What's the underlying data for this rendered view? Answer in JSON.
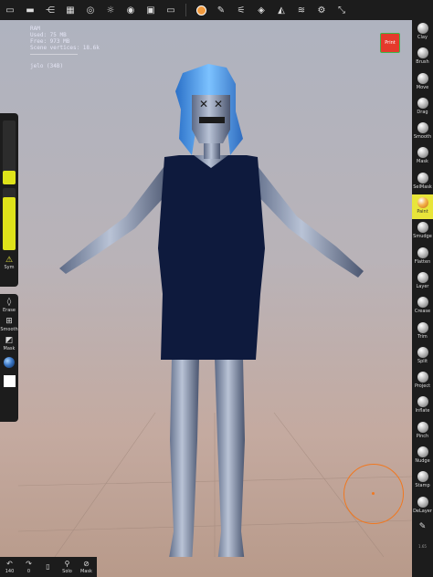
{
  "topbar": {
    "icons": [
      "files-icon",
      "folder-icon",
      "scene-tree-icon",
      "grid-icon",
      "target-icon",
      "sun-icon",
      "material-icon",
      "image-icon",
      "camera-icon",
      "orange-dot-icon",
      "pen-icon",
      "brush-settings-icon",
      "snapshot-icon",
      "symmetry-icon",
      "layers-icon",
      "settings-icon",
      "collapse-icon"
    ]
  },
  "stats": {
    "ram": "RAM",
    "used": "Used: 75 MB",
    "free": "Free: 973 MB",
    "scene_vertices": "Scene vertices: 18.6k",
    "selection": "jelo (34B)"
  },
  "print_button": {
    "label": "Print"
  },
  "right_tools": [
    {
      "label": "Clay",
      "icon": "clay-icon"
    },
    {
      "label": "Brush",
      "icon": "brush-icon"
    },
    {
      "label": "Move",
      "icon": "move-icon"
    },
    {
      "label": "Drag",
      "icon": "drag-icon"
    },
    {
      "label": "Smooth",
      "icon": "smooth-icon"
    },
    {
      "label": "Mask",
      "icon": "mask-icon"
    },
    {
      "label": "SelMask",
      "icon": "selmask-icon"
    },
    {
      "label": "Paint",
      "icon": "paint-icon",
      "active": true
    },
    {
      "label": "Smudge",
      "icon": "smudge-icon"
    },
    {
      "label": "Flatten",
      "icon": "flatten-icon"
    },
    {
      "label": "Layer",
      "icon": "layer-icon"
    },
    {
      "label": "Crease",
      "icon": "crease-icon"
    },
    {
      "label": "Trim",
      "icon": "trim-icon"
    },
    {
      "label": "Split",
      "icon": "split-icon"
    },
    {
      "label": "Project",
      "icon": "project-icon"
    },
    {
      "label": "Inflate",
      "icon": "inflate-icon"
    },
    {
      "label": "Pinch",
      "icon": "pinch-icon"
    },
    {
      "label": "Nudge",
      "icon": "nudge-icon"
    },
    {
      "label": "Stamp",
      "icon": "stamp-icon"
    },
    {
      "label": "DeLayer",
      "icon": "delayer-icon"
    },
    {
      "label": "",
      "icon": "pencil-icon"
    }
  ],
  "right_panel_version": "1.65",
  "left_panel": {
    "sym_label": "Sym",
    "radius_level": 0.22,
    "intensity_level": 0.85,
    "erase_label": "Erase",
    "smooth_label": "Smooth",
    "mask_label": "Mask"
  },
  "bottombar": {
    "undo_label": "140",
    "redo_label": "0",
    "item3_label": "",
    "solo_label": "Solo",
    "mask_label": "Mask"
  },
  "colors": {
    "toolbar_bg": "#1c1c1c",
    "accent_yellow": "#e8e53a",
    "gizmo_orange": "#f07820",
    "print_red": "#e53a2b"
  }
}
